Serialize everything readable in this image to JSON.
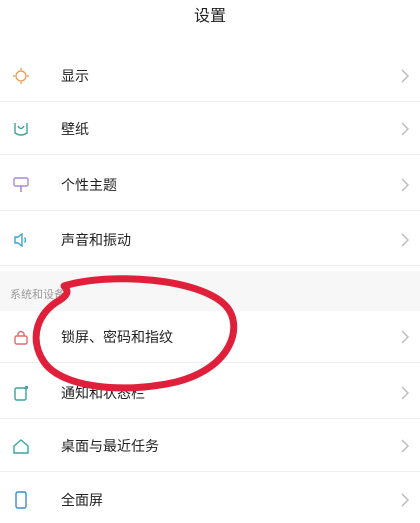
{
  "header": {
    "title": "设置"
  },
  "group1": {
    "items": [
      {
        "label": "显示",
        "icon": "display-brightness-icon"
      },
      {
        "label": "壁纸",
        "icon": "wallpaper-icon"
      },
      {
        "label": "个性主题",
        "icon": "theme-brush-icon"
      },
      {
        "label": "声音和振动",
        "icon": "sound-icon"
      }
    ]
  },
  "section": {
    "title": "系统和设备"
  },
  "group2": {
    "items": [
      {
        "label": "锁屏、密码和指纹",
        "icon": "lock-icon"
      },
      {
        "label": "通知和状态栏",
        "icon": "notification-icon"
      },
      {
        "label": "桌面与最近任务",
        "icon": "home-icon"
      },
      {
        "label": "全面屏",
        "icon": "fullscreen-phone-icon"
      }
    ]
  },
  "colors": {
    "display_icon": "#f0a05a",
    "wallpaper_icon": "#3ba39c",
    "theme_icon": "#a98ad6",
    "sound_icon": "#3aa3d6",
    "lock_icon": "#e46b6b",
    "notification_icon": "#3aa3a3",
    "home_icon": "#3aa3a3",
    "fullscreen_icon": "#3a8bd6",
    "annotation": "#e0203a"
  }
}
